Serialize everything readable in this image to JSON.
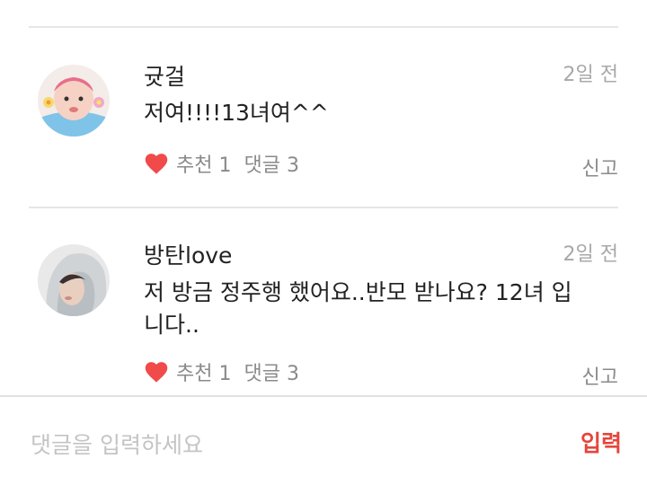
{
  "comments": [
    {
      "username": "귯걸",
      "time": "2일 전",
      "text": "저여!!!!13녀여^^",
      "like_label": "추천 1",
      "reply_label": "댓글 3",
      "report_label": "신고"
    },
    {
      "username": "방탄love",
      "time": "2일 전",
      "text": "저 방금 정주행 했어요..반모 받나요? 12녀 입니다..",
      "like_label": "추천 1",
      "reply_label": "댓글 3",
      "report_label": "신고"
    }
  ],
  "input": {
    "placeholder": "댓글을 입력하세요",
    "submit_label": "입력"
  },
  "colors": {
    "heart": "#f04a4a",
    "submit": "#e5463b"
  }
}
